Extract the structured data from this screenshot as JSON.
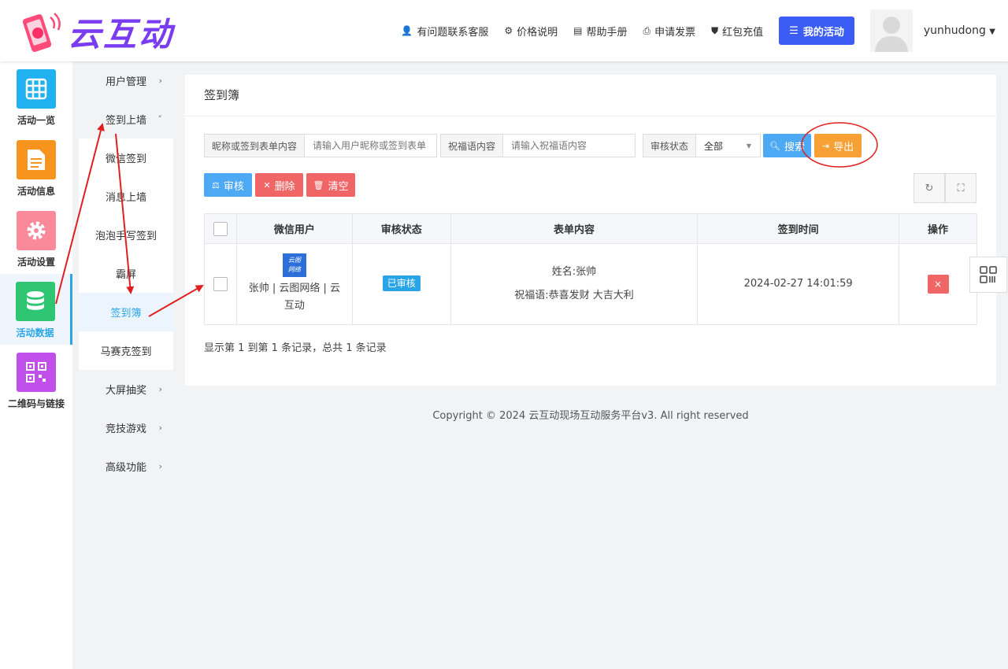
{
  "header": {
    "logo_text": "云互动",
    "nav": [
      {
        "icon": "user-plus-icon",
        "label": "有问题联系客服"
      },
      {
        "icon": "gear-icon",
        "label": "价格说明"
      },
      {
        "icon": "book-icon",
        "label": "帮助手册"
      },
      {
        "icon": "printer-icon",
        "label": "申请发票"
      },
      {
        "icon": "shield-check-icon",
        "label": "红包充值"
      }
    ],
    "my_activity_label": "我的活动",
    "username": "yunhudong"
  },
  "leftbar": [
    {
      "label": "活动一览",
      "icon": "grid-icon",
      "color": "#1fb1f0"
    },
    {
      "label": "活动信息",
      "icon": "document-icon",
      "color": "#f7941d"
    },
    {
      "label": "活动设置",
      "icon": "gear-icon",
      "color": "#fa8a99"
    },
    {
      "label": "活动数据",
      "icon": "database-icon",
      "color": "#2ec672",
      "active": true
    },
    {
      "label": "二维码与链接",
      "icon": "qrcode-icon",
      "color": "#c14fe9"
    }
  ],
  "submenu": [
    {
      "label": "用户管理",
      "chevron": "›"
    },
    {
      "label": "签到上墙",
      "chevron": "˅"
    },
    {
      "label": "微信签到"
    },
    {
      "label": "消息上墙"
    },
    {
      "label": "泡泡手写签到"
    },
    {
      "label": "霸屏"
    },
    {
      "label": "签到簿",
      "active": true
    },
    {
      "label": "马赛克签到"
    },
    {
      "label": "大屏抽奖",
      "chevron": "›"
    },
    {
      "label": "竞技游戏",
      "chevron": "›"
    },
    {
      "label": "高级功能",
      "chevron": "›"
    }
  ],
  "page": {
    "title": "签到簿",
    "filters": {
      "nickname_label": "昵称或签到表单内容",
      "nickname_placeholder": "请输入用户昵称或签到表单",
      "blessing_label": "祝福语内容",
      "blessing_placeholder": "请输入祝福语内容",
      "status_label": "审核状态",
      "status_value": "全部"
    },
    "buttons": {
      "search": "搜索",
      "export": "导出",
      "approve": "审核",
      "delete": "删除",
      "clear": "清空"
    },
    "table": {
      "headers": [
        "微信用户",
        "审核状态",
        "表单内容",
        "签到时间",
        "操作"
      ],
      "rows": [
        {
          "avatar_text_1": "云图",
          "avatar_text_2": "网络",
          "user": "张帅 | 云图网络 | 云互动",
          "status": "已审核",
          "form_line1": "姓名:张帅",
          "form_line2": "祝福语:恭喜发财 大吉大利",
          "time": "2024-02-27 14:01:59",
          "action": "×"
        }
      ]
    },
    "pagination": "显示第 1 到第 1 条记录，总共 1 条记录"
  },
  "footer": "Copyright © 2024 云互动现场互动服务平台v3. All right reserved",
  "colors": {
    "primary": "#3b5df5",
    "info": "#2aa5e8",
    "search_btn": "#4da9f3",
    "export_btn": "#f7a035",
    "danger": "#f06565",
    "annotation": "#e02020"
  }
}
